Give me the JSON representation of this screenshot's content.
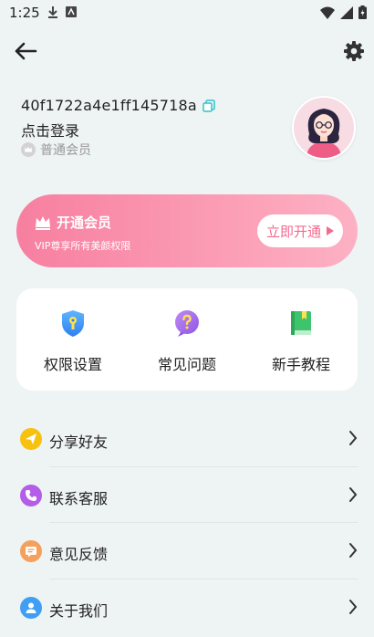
{
  "status_bar": {
    "time": "1:25",
    "icons": [
      "download-icon",
      "app-notification-icon",
      "wifi-icon",
      "signal-icon",
      "battery-charging-icon"
    ]
  },
  "header": {
    "back_icon": "arrow-left-icon",
    "settings_icon": "gear-icon"
  },
  "profile": {
    "user_id": "40f1722a4e1ff145718a",
    "login_prompt": "点击登录",
    "membership_level": "普通会员"
  },
  "vip_banner": {
    "title": "开通会员",
    "subtitle": "VIP尊享所有美颜权限",
    "button_label": "立即开通",
    "colors": {
      "start": "#f77fa0",
      "end": "#fdb1c4",
      "button_text": "#f46a8d"
    }
  },
  "shortcuts": [
    {
      "label": "权限设置",
      "icon": "shield-key-icon"
    },
    {
      "label": "常见问题",
      "icon": "question-bubble-icon"
    },
    {
      "label": "新手教程",
      "icon": "book-icon"
    }
  ],
  "menu": [
    {
      "label": "分享好友",
      "icon": "paper-plane-icon",
      "color": "#f6c20f"
    },
    {
      "label": "联系客服",
      "icon": "phone-icon",
      "color": "#b45de8"
    },
    {
      "label": "意见反馈",
      "icon": "message-icon",
      "color": "#f5a05b"
    },
    {
      "label": "关于我们",
      "icon": "person-icon",
      "color": "#3f9ff3"
    }
  ]
}
